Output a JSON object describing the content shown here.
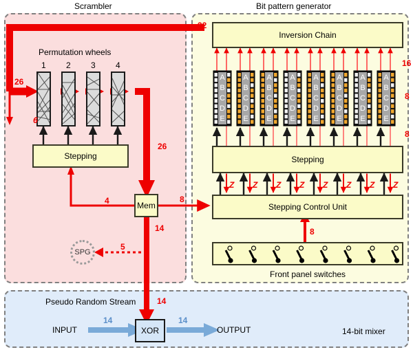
{
  "titles": {
    "scrambler": "Scrambler",
    "bit_pattern_generator": "Bit pattern generator",
    "mixer": "14-bit mixer"
  },
  "scrambler": {
    "wheels_caption": "Permutation wheels",
    "wheel_numbers": [
      "1",
      "2",
      "3",
      "4"
    ],
    "stepping_label": "Stepping",
    "mem_label": "Mem",
    "spg_label": "SPG",
    "labels": {
      "input_width": "26",
      "drop_width": "6",
      "feedback_width": "26",
      "stepping_feedback": "4",
      "mem_out_width": "8",
      "mem_down_width": "14",
      "spg_width": "5"
    }
  },
  "bpg": {
    "inversion_chain_label": "Inversion Chain",
    "stepping_label": "Stepping",
    "stepping_control_label": "Stepping Control Unit",
    "front_panel_label": "Front panel switches",
    "unit_letters": [
      "A",
      "B",
      "C",
      "D",
      "E"
    ],
    "unit_count": 8,
    "switch_count": 8,
    "z_label": "Z",
    "z_count": 8,
    "labels": {
      "chain_in_width": "32",
      "chain_out_width": "16",
      "unit_out_width": "8",
      "unit_in_width": "8",
      "switches_width": "8"
    }
  },
  "mixer": {
    "stream_label": "Pseudo Random Stream",
    "input_label": "INPUT",
    "output_label": "OUTPUT",
    "xor_label": "XOR",
    "labels": {
      "key_width": "14",
      "input_width": "14",
      "output_width": "14"
    }
  },
  "colors": {
    "red": "#ee0000",
    "blue": "#7aaad8",
    "scrambler_bg": "#fbdede",
    "bpg_bg": "#fcfce0",
    "mixer_bg": "#e0ecfa",
    "box_yellow": "#fbfbc8",
    "wheel_grey": "#dcdcdc",
    "unit_orange": "#f0a830",
    "unit_black": "#101010"
  }
}
